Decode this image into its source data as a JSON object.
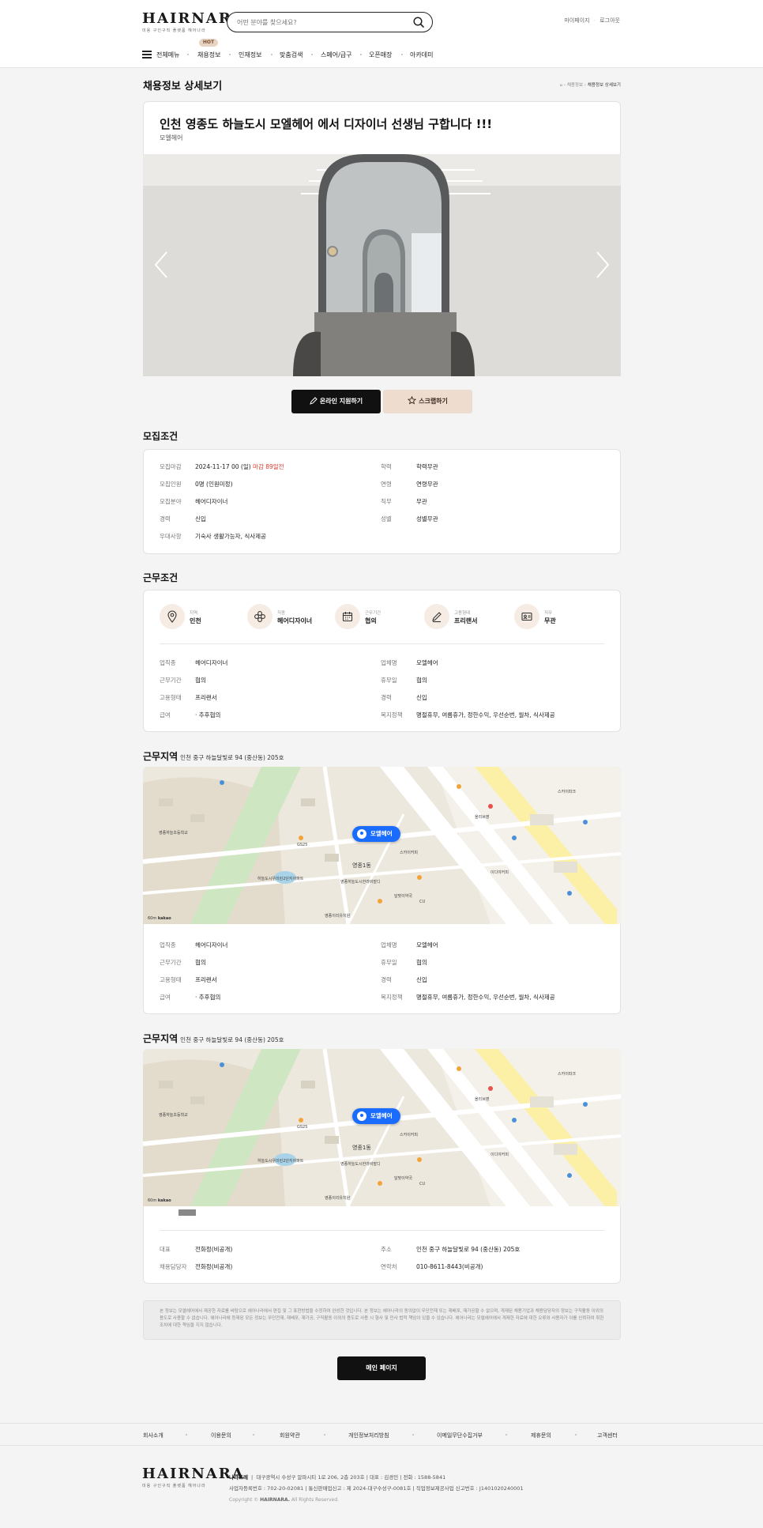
{
  "header": {
    "logo": "HAIRNARA",
    "logo_sub": "미용 구인구직 플랫폼 헤어나라",
    "search_placeholder": "어떤 분야를 찾으세요?",
    "links": [
      "마이페이지",
      "로그아웃"
    ],
    "nav": {
      "menu_label": "전체메뉴",
      "items": [
        "채용정보",
        "인재정보",
        "맞춤검색",
        "스페어/급구",
        "오픈매장",
        "아카데미"
      ],
      "hot_badge": "HOT"
    }
  },
  "page": {
    "title": "채용정보 상세보기",
    "breadcrumb": [
      "채용정보",
      "채용정보 상세보기"
    ]
  },
  "job": {
    "title": "인천 영종도 하늘도시 모엘헤어 에서 디자이너 선생님 구합니다 !!!",
    "company": "모엘헤어",
    "apply_button": "온라인 지원하기",
    "scrap_button": "스크랩하기"
  },
  "recruit": {
    "title": "모집조건",
    "left": [
      {
        "k": "모집마감",
        "v": "2024-11-17 00 (일)",
        "extra": "마감 89일전"
      },
      {
        "k": "모집인원",
        "v": "0명 (인원미정)"
      },
      {
        "k": "모집분야",
        "v": "헤어디자이너"
      },
      {
        "k": "경력",
        "v": "신입"
      },
      {
        "k": "우대사항",
        "v": "기숙사 생활가능자, 식사제공"
      }
    ],
    "right": [
      {
        "k": "학력",
        "v": "학력무관"
      },
      {
        "k": "연령",
        "v": "연령무관"
      },
      {
        "k": "직무",
        "v": "무관"
      },
      {
        "k": "성별",
        "v": "성별무관"
      }
    ]
  },
  "work": {
    "title": "근무조건",
    "icons": [
      {
        "label": "지역",
        "value": "인천",
        "icon": "location-icon"
      },
      {
        "label": "직종",
        "value": "헤어디자이너",
        "icon": "category-icon"
      },
      {
        "label": "근무기간",
        "value": "협의",
        "icon": "calendar-icon"
      },
      {
        "label": "고용형태",
        "value": "프리랜서",
        "icon": "pen-icon"
      },
      {
        "label": "직무",
        "value": "무관",
        "icon": "id-card-icon"
      }
    ],
    "left": [
      {
        "k": "업직종",
        "v": "헤어디자이너"
      },
      {
        "k": "근무기간",
        "v": "협의"
      },
      {
        "k": "고용형태",
        "v": "프리랜서"
      },
      {
        "k": "급여",
        "v": "· 추후협의"
      }
    ],
    "right": [
      {
        "k": "업체명",
        "v": "모엘헤어"
      },
      {
        "k": "휴무일",
        "v": "협의"
      },
      {
        "k": "경력",
        "v": "신입"
      },
      {
        "k": "복지정책",
        "v": "명절휴무, 여름휴가, 정한수익, 우선순번, 월차, 식사제공"
      }
    ]
  },
  "location": {
    "title": "근무지역",
    "address": "인천 중구 하늘달빛로 94 (중산동) 205호",
    "pin": "모엘헤어",
    "map_scale": "60m",
    "map_brand": "kakao",
    "labels": [
      "영종1동",
      "영종하늘도시한라비발디",
      "하늘도시우미린2단지아파트",
      "스카이커피",
      "영종하늘초등학교",
      "올리브영",
      "스카이파크",
      "GS25",
      "CU",
      "이디야커피",
      "달맞이약국",
      "영종이리유치원"
    ]
  },
  "contact": {
    "left": [
      {
        "k": "대표",
        "v": "전화정(비공개)"
      },
      {
        "k": "채용담당자",
        "v": "전화정(비공개)"
      }
    ],
    "right": [
      {
        "k": "주소",
        "v": "인천 중구 하늘달빛로 94 (중산동) 205호"
      },
      {
        "k": "연락처",
        "v": "010-8611-8443(비공개)"
      }
    ]
  },
  "notice": "본 정보는 모엘헤어에서 제공한 자료를 바탕으로 헤어나라에서 편집 및 그 표현방법을 수정하여 완성한 것입니다. 본 정보는 헤어나라의 동의없이 무단전재 또는 재배포, 재가공할 수 없으며, 게재된 채용기업과 채용담당자의 정보는 구직활동 이외의 용도로 사용할 수 없습니다. 헤어나라에 등재된 모든 정보는 무단전재, 재배포, 재가공, 구직활동 이외의 용도로 사용 시 형사 및 민사 법적 책임이 있을 수 있습니다. 헤어나라는 모엘헤어에서 게재한 자료에 대한 오류와 사용자가 이를 신뢰하여 취한 조치에 대한 책임을 지지 않습니다.",
  "main_button": "메인 페이지",
  "footer": {
    "links": [
      "회사소개",
      "이용문의",
      "회원약관",
      "개인정보처리방침",
      "이메일무단수집거부",
      "제휴문의",
      "고객센터"
    ],
    "company": "나라트레",
    "info1": "대구광역시 수성구 알파시티 1로 206, 2층 203호  |  대표 : 김경민  |  전화 : 1588-5841",
    "info2": "사업자등록번호 : 702-20-02081  |  통신판매업신고 : 제 2024-대구수성구-0081호  |  직업정보제공사업 신고번호 : J1401020240001",
    "copyright_prefix": "Copyright ©",
    "copyright_brand": "HAIRNARA.",
    "copyright_suffix": "All Rights Reserved."
  }
}
